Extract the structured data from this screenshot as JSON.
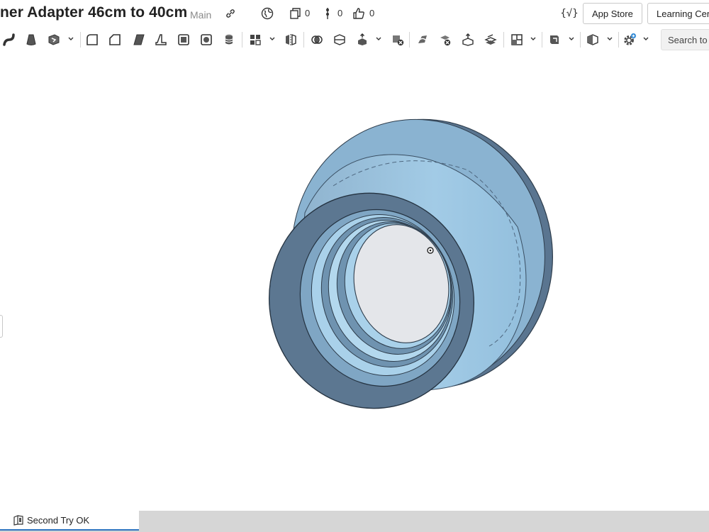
{
  "header": {
    "title": "ner Adapter 46cm to 40cm",
    "workspace": "Main",
    "versions_count": "0",
    "branches_count": "0",
    "likes_count": "0",
    "app_store_label": "App Store",
    "learning_center_label": "Learning Cer"
  },
  "toolbar": {
    "search_placeholder": "Search to",
    "tools": [
      "sweep-icon",
      "loft-icon",
      "thicken-icon",
      "fillet-icon",
      "chamfer-icon",
      "draft-icon",
      "rib-icon",
      "shell-icon",
      "hole-icon",
      "cylinder-icon",
      "pattern-icon",
      "mirror-icon",
      "boolean-icon",
      "split-icon",
      "transform-icon",
      "delete-part-icon",
      "replace-face-icon",
      "delete-face-icon",
      "move-face-icon",
      "offset-surface-icon",
      "plane-icon",
      "mate-connector-icon",
      "section-icon",
      "custom-feature-icon"
    ]
  },
  "tabs": [
    {
      "label": "Second Try OK",
      "active": true
    }
  ],
  "colors": {
    "part_fill": "#9ec6e2",
    "part_dark": "#56708a",
    "tab_accent": "#2f74c0"
  }
}
